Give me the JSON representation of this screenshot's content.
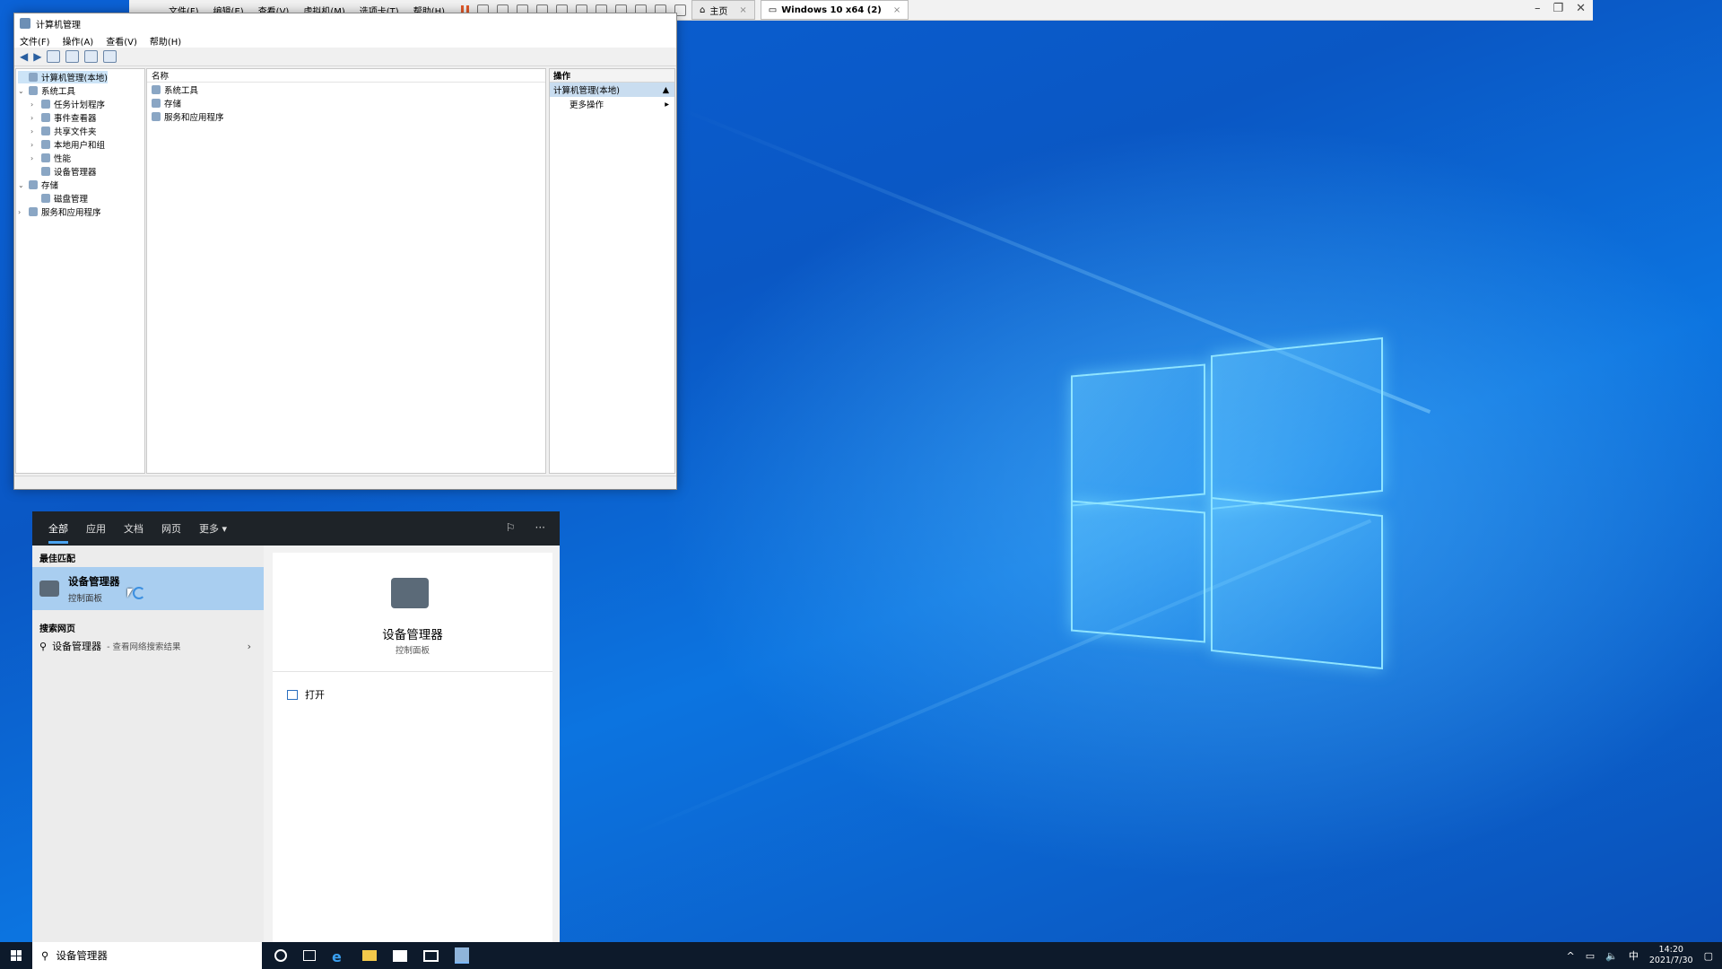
{
  "vmware": {
    "menu": [
      "文件(F)",
      "编辑(E)",
      "查看(V)",
      "虚拟机(M)",
      "选项卡(T)",
      "帮助(H)"
    ],
    "tabs": [
      {
        "label": "主页",
        "active": false
      },
      {
        "label": "Windows 10 x64 (2)",
        "active": true
      }
    ]
  },
  "cm": {
    "title": "计算机管理",
    "menu": [
      "文件(F)",
      "操作(A)",
      "查看(V)",
      "帮助(H)"
    ],
    "tree": [
      {
        "label": "计算机管理(本地)",
        "level": 0,
        "expander": "",
        "selected": true
      },
      {
        "label": "系统工具",
        "level": 1,
        "expander": "⌄",
        "selected": false
      },
      {
        "label": "任务计划程序",
        "level": 2,
        "expander": "›",
        "selected": false
      },
      {
        "label": "事件查看器",
        "level": 2,
        "expander": "›",
        "selected": false
      },
      {
        "label": "共享文件夹",
        "level": 2,
        "expander": "›",
        "selected": false
      },
      {
        "label": "本地用户和组",
        "level": 2,
        "expander": "›",
        "selected": false
      },
      {
        "label": "性能",
        "level": 2,
        "expander": "›",
        "selected": false
      },
      {
        "label": "设备管理器",
        "level": 2,
        "expander": "",
        "selected": false
      },
      {
        "label": "存储",
        "level": 1,
        "expander": "⌄",
        "selected": false
      },
      {
        "label": "磁盘管理",
        "level": 2,
        "expander": "",
        "selected": false
      },
      {
        "label": "服务和应用程序",
        "level": 1,
        "expander": "›",
        "selected": false
      }
    ],
    "center": {
      "header": "名称",
      "rows": [
        "系统工具",
        "存储",
        "服务和应用程序"
      ]
    },
    "actions": {
      "header": "操作",
      "section": "计算机管理(本地)",
      "items": [
        "更多操作"
      ]
    }
  },
  "search_panel": {
    "tabs": [
      "全部",
      "应用",
      "文档",
      "网页",
      "更多"
    ],
    "best_match_label": "最佳匹配",
    "best_match": {
      "title": "设备管理器",
      "subtitle": "控制面板"
    },
    "web_label": "搜索网页",
    "web_row": {
      "term": "设备管理器",
      "suffix": " - 查看网络搜索结果"
    },
    "detail": {
      "title": "设备管理器",
      "subtitle": "控制面板",
      "open_label": "打开"
    }
  },
  "taskbar": {
    "search_value": "设备管理器",
    "ime": "中",
    "time": "14:20",
    "date": "2021/7/30"
  }
}
